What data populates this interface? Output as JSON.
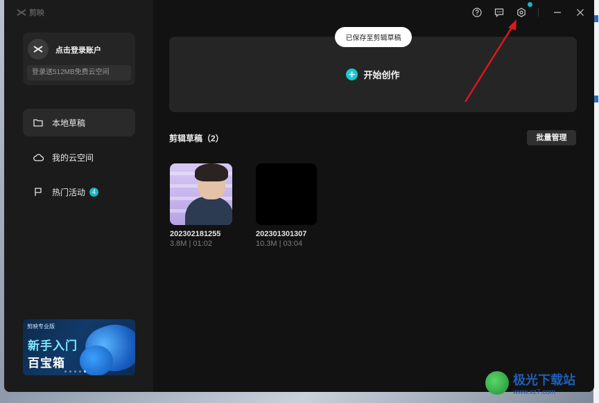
{
  "app": {
    "logo_text": "剪映",
    "accent_color": "#19b5c8"
  },
  "account": {
    "login_label": "点击登录账户",
    "cloud_offer": "登录送512MB免费云空间"
  },
  "sidebar": {
    "items": [
      {
        "label": "本地草稿",
        "icon": "folder-icon",
        "active": true
      },
      {
        "label": "我的云空间",
        "icon": "cloud-icon",
        "active": false
      },
      {
        "label": "热门活动",
        "icon": "flag-icon",
        "active": false,
        "badge": "4"
      }
    ]
  },
  "banner": {
    "brand": "剪映专业版",
    "line1": "新手入门",
    "line2": "百宝箱"
  },
  "window_controls": {
    "icons": [
      "help-icon",
      "feedback-icon",
      "settings-icon",
      "minimize-icon",
      "close-icon"
    ]
  },
  "toast": {
    "text": "已保存至剪辑草稿"
  },
  "create": {
    "label": "开始创作"
  },
  "drafts_section": {
    "title": "剪辑草稿（2）",
    "batch_label": "批量管理",
    "items": [
      {
        "name": "202302181255",
        "meta": "3.8M | 01:02"
      },
      {
        "name": "202301301307",
        "meta": "10.3M | 03:04"
      }
    ]
  },
  "watermark": {
    "title": "极光下载站",
    "url": "www.xz7.com"
  }
}
